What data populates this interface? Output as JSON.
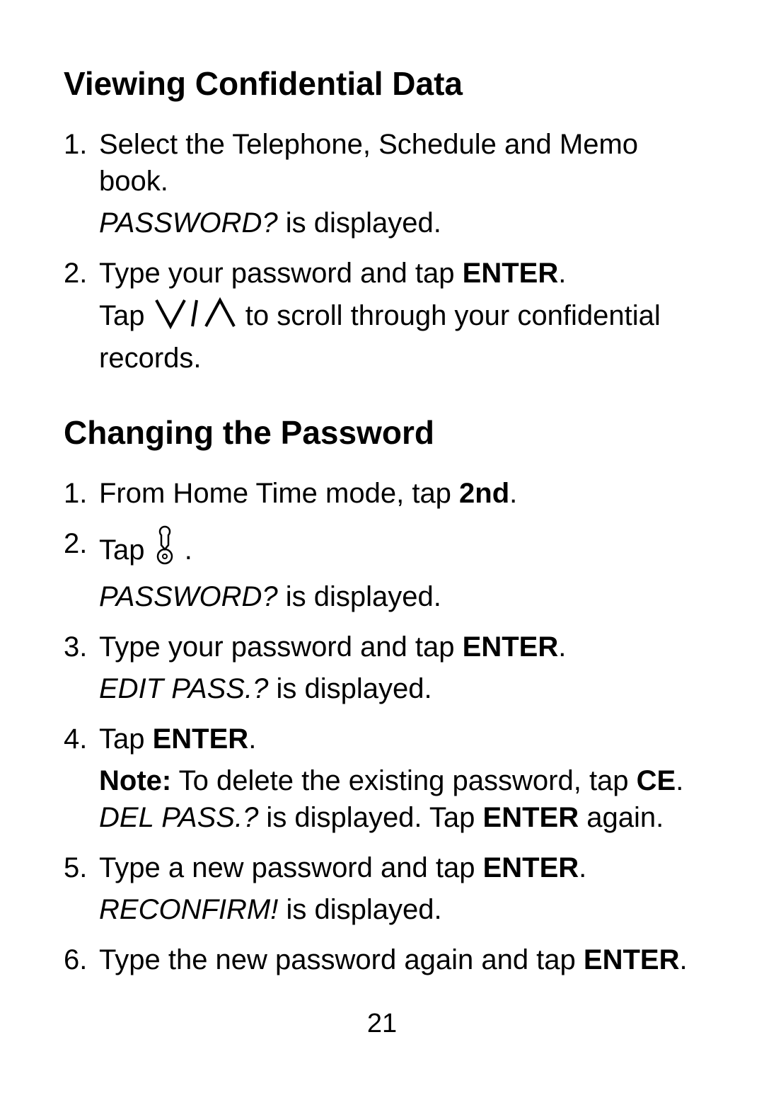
{
  "page_number": "21",
  "sections": [
    {
      "heading": "Viewing Confidential Data",
      "steps": [
        {
          "num": "1.",
          "lines": [
            [
              {
                "t": "Select the Telephone, Schedule and Memo book."
              }
            ],
            [
              {
                "t": "PASSWORD?",
                "style": "italic"
              },
              {
                "t": " is displayed."
              }
            ]
          ]
        },
        {
          "num": "2.",
          "lines": [
            [
              {
                "t": "Type your password and tap "
              },
              {
                "t": "ENTER",
                "style": "bold"
              },
              {
                "t": "."
              }
            ],
            [
              {
                "t": "Tap "
              },
              {
                "icon": "down-up-scroll-icon"
              },
              {
                "t": " to scroll through your confidential records."
              }
            ]
          ]
        }
      ]
    },
    {
      "heading": "Changing the Password",
      "steps": [
        {
          "num": "1.",
          "lines": [
            [
              {
                "t": "From Home Time mode, tap "
              },
              {
                "t": "2nd",
                "style": "bold"
              },
              {
                "t": "."
              }
            ]
          ]
        },
        {
          "num": "2.",
          "lines": [
            [
              {
                "t": "Tap "
              },
              {
                "icon": "key-icon"
              },
              {
                "t": " ."
              }
            ],
            [
              {
                "t": "PASSWORD?",
                "style": "italic"
              },
              {
                "t": " is displayed."
              }
            ]
          ]
        },
        {
          "num": "3.",
          "lines": [
            [
              {
                "t": "Type your password and tap "
              },
              {
                "t": "ENTER",
                "style": "bold"
              },
              {
                "t": "."
              }
            ],
            [
              {
                "t": "EDIT PASS.?",
                "style": "italic"
              },
              {
                "t": " is displayed."
              }
            ]
          ]
        },
        {
          "num": "4.",
          "lines": [
            [
              {
                "t": "Tap "
              },
              {
                "t": "ENTER",
                "style": "bold"
              },
              {
                "t": "."
              }
            ],
            [
              {
                "t": "Note:",
                "style": "bold"
              },
              {
                "t": " To delete the existing password, tap "
              },
              {
                "t": "CE",
                "style": "bold"
              },
              {
                "t": ". "
              },
              {
                "t": "DEL PASS.?",
                "style": "italic"
              },
              {
                "t": " is displayed. Tap "
              },
              {
                "t": "ENTER",
                "style": "bold"
              },
              {
                "t": " again."
              }
            ]
          ]
        },
        {
          "num": "5.",
          "lines": [
            [
              {
                "t": "Type a new password and tap "
              },
              {
                "t": "ENTER",
                "style": "bold"
              },
              {
                "t": "."
              }
            ],
            [
              {
                "t": "RECONFIRM!",
                "style": "italic"
              },
              {
                "t": " is displayed."
              }
            ]
          ]
        },
        {
          "num": "6.",
          "lines": [
            [
              {
                "t": "Type the new password again and tap "
              },
              {
                "t": "ENTER",
                "style": "bold"
              },
              {
                "t": "."
              }
            ]
          ]
        }
      ]
    }
  ]
}
